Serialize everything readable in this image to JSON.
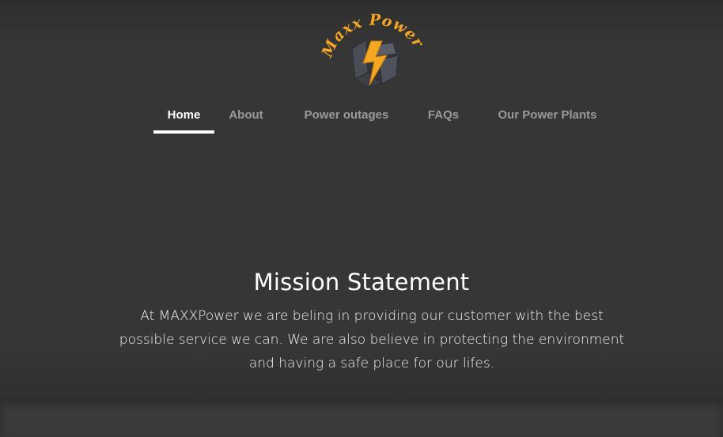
{
  "logo": {
    "text": "Maxx Power",
    "accent_color": "#f5a623",
    "icon": "lightning-bolt-icon"
  },
  "nav": {
    "items": [
      {
        "label": "Home",
        "active": true
      },
      {
        "label": "About",
        "active": false
      },
      {
        "label": "Power outages",
        "active": false
      },
      {
        "label": "FAQs",
        "active": false
      },
      {
        "label": "Our Power Plants",
        "active": false
      }
    ]
  },
  "mission": {
    "title": "Mission Statement",
    "text": "At MAXXPower we are beling in providing our customer with the best possible service we can. We are also believe in protecting the environment and having a safe place for our lifes."
  },
  "colors": {
    "background": "#363636",
    "nav_inactive": "#9a9a9a",
    "nav_active": "#ffffff"
  }
}
